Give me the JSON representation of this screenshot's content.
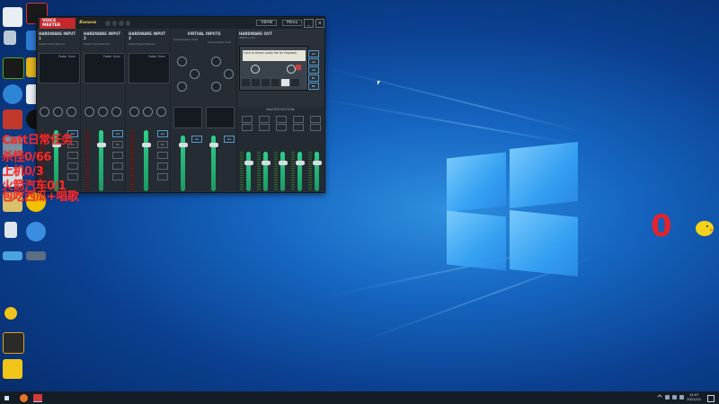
{
  "overlay_lines": [
    "Catt日常任务",
    "杀怪0/66",
    "上机0/3",
    "火箭汽车0/1",
    "包吃西瓜+唱歌"
  ],
  "counter": "0",
  "voicemeeter": {
    "brand_tag": "VOICE MEETER",
    "brand_sub": "Banana",
    "menu_button": "Menu",
    "vban_button": "VBAN",
    "inputs": [
      {
        "name": "HARDWARE INPUT 1",
        "sub": "Select Input Device",
        "label": "Fader Gain"
      },
      {
        "name": "HARDWARE INPUT 2",
        "sub": "Select Input Device",
        "label": "Fader Gain"
      },
      {
        "name": "HARDWARE INPUT 3",
        "sub": "Select Input Device",
        "label": "Fader Gain"
      }
    ],
    "virtual_inputs": {
      "title": "VIRTUAL INPUTS",
      "left": "Voicemeeter VAIO",
      "right": "Voicemeeter AUX"
    },
    "hardware_out": {
      "title": "HARDWARE OUT",
      "sub": "48kHz | 512"
    },
    "cassette_text": "Click to Select Audio file for Playback",
    "master_section": "MASTER SECTION",
    "stereo_repeat": "STEREO REPEAT",
    "bus_labels": [
      "A1",
      "A2",
      "A3",
      "B1",
      "B2"
    ],
    "strip_label": "INTELLIPAN"
  },
  "taskbar": {
    "time": "14:07",
    "date": "2021/1/1"
  },
  "colors": {
    "overlay_red": "#ff2b2b",
    "counter_red": "#e3232d",
    "fader_green": "#2ecf8b",
    "vm_bg": "#2a3038"
  }
}
